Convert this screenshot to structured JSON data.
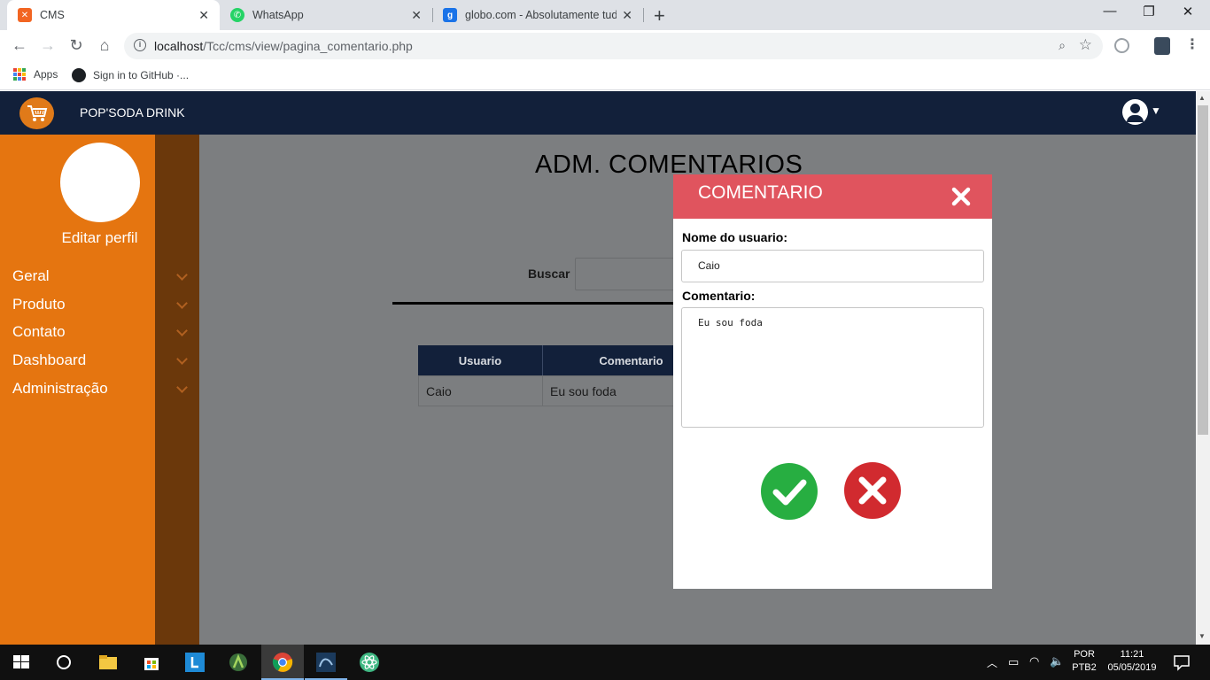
{
  "browser": {
    "tabs": [
      {
        "title": "CMS",
        "favicon": "xampp-icon",
        "color": "#f26522"
      },
      {
        "title": "WhatsApp",
        "favicon": "whatsapp-icon",
        "color": "#25d366"
      },
      {
        "title": "globo.com - Absolutamente tudo",
        "favicon": "google-icon",
        "color": "#1a73e8"
      }
    ],
    "url_host": "localhost",
    "url_path": "/Tcc/cms/view/pagina_comentario.php",
    "bookmarks": [
      {
        "label": "Apps",
        "icon": "apps-grid-icon"
      },
      {
        "label": "Sign in to GitHub ·...",
        "icon": "github-icon"
      }
    ]
  },
  "app": {
    "brand": "POP'SODA DRINK",
    "accent": "#e57510",
    "header_bg": "#12203a"
  },
  "sidebar": {
    "edit_profile": "Editar perfil",
    "items": [
      {
        "label": "Geral"
      },
      {
        "label": "Produto"
      },
      {
        "label": "Contato"
      },
      {
        "label": "Dashboard"
      },
      {
        "label": "Administração"
      }
    ]
  },
  "main": {
    "title": "ADM. COMENTARIOS",
    "search_label": "Buscar",
    "search_value": "",
    "table": {
      "columns": [
        "Usuario",
        "Comentario"
      ],
      "rows": [
        [
          "Caio",
          "Eu sou foda"
        ]
      ]
    }
  },
  "modal": {
    "title": "COMENTARIO",
    "header_color": "#e0545e",
    "user_label": "Nome do usuario:",
    "user_value": "Caio",
    "comment_label": "Comentario:",
    "comment_value": "Eu sou foda"
  },
  "taskbar": {
    "lang_top": "POR",
    "lang_bottom": "PTB2",
    "time": "11:21",
    "date": "05/05/2019"
  }
}
